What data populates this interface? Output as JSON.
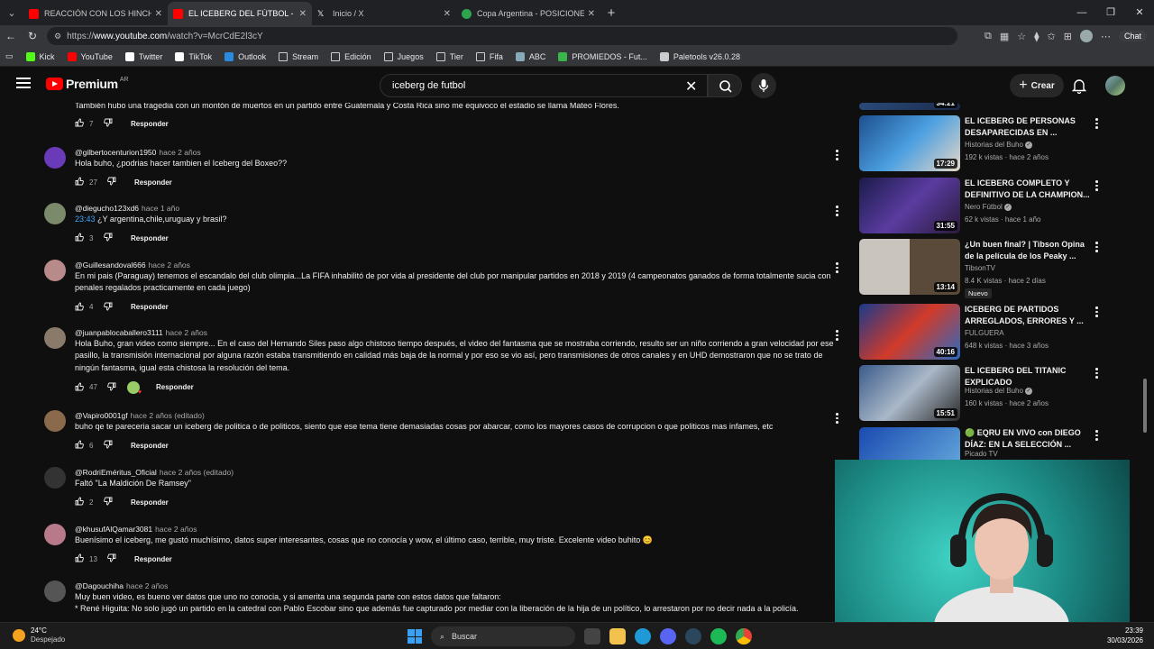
{
  "browser": {
    "tabs": [
      {
        "title": "REACCIÓN CON LOS HINCHAS / R",
        "icon": "youtube-icon",
        "active": false
      },
      {
        "title": "EL ICEBERG DEL FÚTBOL - YouTub",
        "icon": "youtube-icon",
        "active": true
      },
      {
        "title": "Inicio / X",
        "icon": "x-icon",
        "active": false
      },
      {
        "title": "Copa Argentina - POSICIONES, RE",
        "icon": "globe-icon",
        "active": false
      }
    ],
    "url_prefix": "https://",
    "url_domain": "www.youtube.com",
    "url_path": "/watch?v=McrCdE2l3cY",
    "chat_label": "Chat",
    "bookmarks": [
      {
        "label": "Kick",
        "icon": "kick-icon",
        "color": "#53fc18"
      },
      {
        "label": "YouTube",
        "icon": "youtube-icon",
        "color": "#ff0000"
      },
      {
        "label": "Twitter",
        "icon": "x-icon",
        "color": "#ffffff"
      },
      {
        "label": "TikTok",
        "icon": "tiktok-icon",
        "color": "#ffffff"
      },
      {
        "label": "Outlook",
        "icon": "outlook-icon",
        "color": "#2a8ae0"
      },
      {
        "label": "Stream",
        "icon": "folder-icon",
        "color": ""
      },
      {
        "label": "Edición",
        "icon": "folder-icon",
        "color": ""
      },
      {
        "label": "Juegos",
        "icon": "folder-icon",
        "color": ""
      },
      {
        "label": "Tier",
        "icon": "folder-icon",
        "color": ""
      },
      {
        "label": "Fifa",
        "icon": "folder-icon",
        "color": ""
      },
      {
        "label": "ABC",
        "icon": "cloud-icon",
        "color": "#8ab"
      },
      {
        "label": "PROMIEDOS - Fut...",
        "icon": "promiedos-icon",
        "color": "#3ab54a"
      },
      {
        "label": "Paletools v26.0.28",
        "icon": "globe-icon",
        "color": "#ccc"
      }
    ]
  },
  "youtube": {
    "brand": "Premium",
    "country": "AR",
    "search_value": "iceberg de futbol",
    "create_label": "Crear",
    "brand_color": "#ff0000"
  },
  "comments": [
    {
      "user": "",
      "time": "",
      "text": "También hubo una tragedia con un montón de muertos en un partido entre Guatemala y Costa Rica sino me equivoco el estadio se llama Mateo Flores.",
      "likes": "7",
      "reply": "Responder"
    },
    {
      "user": "@gilbertocenturion1950",
      "time": "hace 2 años",
      "text": "Hola buho, ¿podrias hacer tambien el Iceberg del Boxeo??",
      "likes": "27",
      "reply": "Responder"
    },
    {
      "user": "@diegucho123xd6",
      "time": "hace 1 año",
      "timestamp": "23:43",
      "text": "¿Y argentina,chile,uruguay y brasil?",
      "likes": "3",
      "reply": "Responder"
    },
    {
      "user": "@Guillesandoval666",
      "time": "hace 2 años",
      "text": "En mi pais (Paraguay) tenemos el escandalo del club olimpia...La FIFA inhabilitó de por vida al presidente del club por manipular partidos en 2018 y 2019 (4 campeonatos ganados de forma totalmente sucia con penales regalados practicamente en cada juego)",
      "likes": "4",
      "reply": "Responder"
    },
    {
      "user": "@juanpablocaballero3111",
      "time": "hace 2 años",
      "text": "Hola Buho, gran video como siempre... En el caso del Hernando Siles paso algo chistoso tiempo después, el video del fantasma que se mostraba corriendo, resulto ser un niño corriendo a gran velocidad por ese pasillo, la transmisión internacional por alguna razón estaba transmitiendo en calidad más baja de la normal y por eso se vio así, pero transmisiones de otros canales y en UHD demostraron que no se trato de ningún fantasma, igual esta chistosa la resolución del tema.",
      "likes": "47",
      "reply": "Responder"
    },
    {
      "user": "@Vapiro0001gf",
      "time": "hace 2 años (editado)",
      "text": "buho qe te  pareceria sacar un iceberg de politica o de politicos, siento que ese tema tiene demasiadas cosas por abarcar, como los mayores casos de corrupcion o que politicos mas infames, etc",
      "likes": "6",
      "reply": "Responder"
    },
    {
      "user": "@RodriEméritus_Oficial",
      "time": "hace 2 años (editado)",
      "text": "Faltó \"La Maldición De Ramsey\"",
      "likes": "2",
      "reply": "Responder"
    },
    {
      "user": "@khusufAlQamar3081",
      "time": "hace 2 años",
      "text": "Buenísimo el iceberg, me gustó muchísimo, datos super interesantes, cosas que no conocía y wow, el último caso, terrible, muy triste. Excelente video buhito 😊",
      "likes": "13",
      "reply": "Responder"
    },
    {
      "user": "@Dagouchiha",
      "time": "hace 2 años",
      "text": "Muy buen video, es bueno ver datos que uno no conocia, y si amerita una segunda parte con estos datos que faltaron:",
      "text2": "* René Higuita: No solo jugó un partido en la catedral con Pablo Escobar sino que además fue capturado por mediar con la liberación de la hija de un político, lo arrestaron por no decir nada a la policía.",
      "likes": "",
      "reply": ""
    }
  ],
  "recommendations": [
    {
      "title": "",
      "channel": "",
      "meta": "",
      "duration": "34:21"
    },
    {
      "title": "EL ICEBERG DE PERSONAS DESAPARECIDAS EN ...",
      "channel": "Historias del Buho",
      "meta": "192 k vistas · hace 2 años",
      "duration": "17:29"
    },
    {
      "title": "EL ICEBERG COMPLETO Y DEFINITIVO DE LA CHAMPION...",
      "channel": "Nero Fútbol",
      "meta": "62 k vistas · hace 1 año",
      "duration": "31:55"
    },
    {
      "title": "¿Un buen final? | Tibson Opina de la película de los Peaky ...",
      "channel": "TibsonTV",
      "meta": "8.4 K vistas · hace 2 días",
      "duration": "13:14",
      "badge": "Nuevo"
    },
    {
      "title": "ICEBERG DE PARTIDOS ARREGLADOS, ERRORES Y ...",
      "channel": "FULGUERA",
      "meta": "648 k vistas · hace 3 años",
      "duration": "40:16"
    },
    {
      "title": "EL ICEBERG DEL TITANIC EXPLICADO",
      "channel": "Historias del Buho",
      "meta": "160 k vistas · hace 2 años",
      "duration": "15:51"
    },
    {
      "title": "🟢 EQRU EN VIVO con DIEGO DÍAZ: EN LA SELECCIÓN ...",
      "channel": "Picado TV",
      "meta": "",
      "duration": ""
    }
  ],
  "taskbar": {
    "temp": "24°C",
    "weather": "Despejado",
    "search_label": "Buscar",
    "time": "23:39",
    "date": "30/03/2026"
  }
}
